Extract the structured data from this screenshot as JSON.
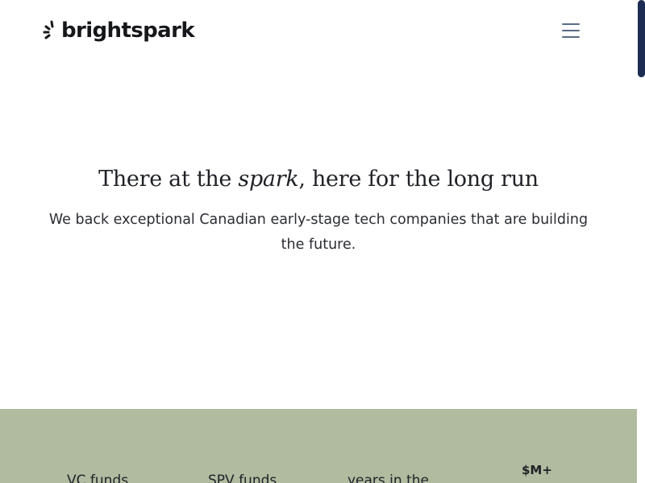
{
  "header": {
    "logo_text": "brightspark",
    "logo_icon": "spark-icon",
    "menu_icon": "hamburger-menu-icon"
  },
  "hero": {
    "title_before": "There at the ",
    "title_em": "spark",
    "title_after": ", here for the long run",
    "text": "We back exceptional Canadian early-stage tech companies that are building the future."
  },
  "stats": {
    "items": [
      {
        "label": "VC funds"
      },
      {
        "label": "SPV funds"
      },
      {
        "label": "years in the"
      },
      {
        "value": "$M+"
      }
    ]
  },
  "colors": {
    "stats_background": "#b1bba0",
    "scrollbar_thumb": "#1c2c52",
    "menu_icon": "#5a6b85",
    "text": "#1f2126"
  }
}
